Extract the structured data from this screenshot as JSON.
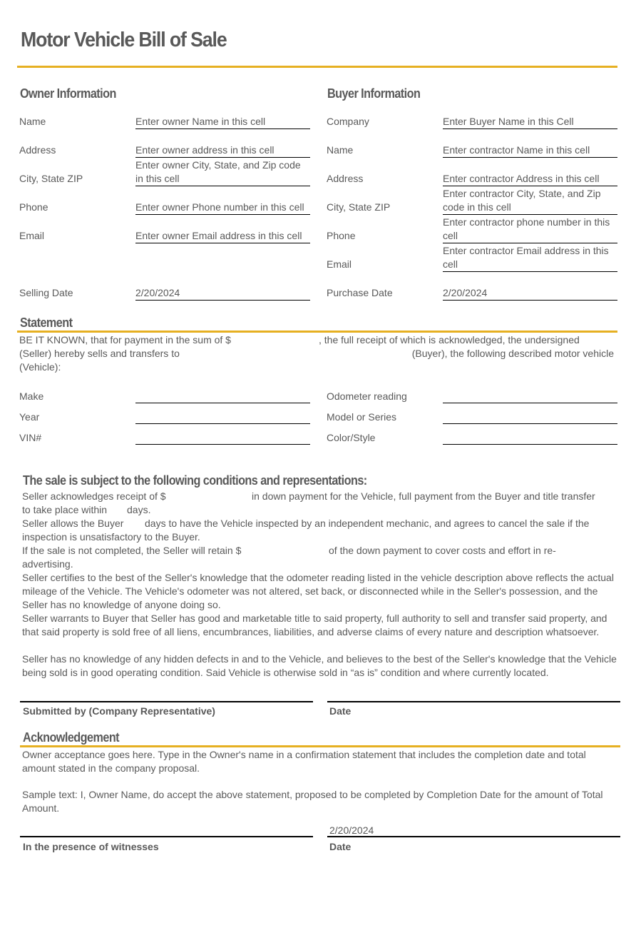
{
  "title": "Motor Vehicle Bill of Sale",
  "accent_color": "#E6B022",
  "owner": {
    "heading": "Owner Information",
    "fields": [
      {
        "label": "Name",
        "value": "Enter owner Name in this cell"
      },
      {
        "label": "Address",
        "value": "Enter owner address in this cell"
      },
      {
        "label": "City, State ZIP",
        "value": "Enter owner City, State, and Zip code in this cell"
      },
      {
        "label": "Phone",
        "value": "Enter owner Phone number in this cell"
      },
      {
        "label": "Email",
        "value": "Enter owner Email address in this cell"
      }
    ],
    "date_label": "Selling Date",
    "date_value": "2/20/2024"
  },
  "buyer": {
    "heading": "Buyer Information",
    "fields": [
      {
        "label": "Company",
        "value": "Enter Buyer Name in this Cell"
      },
      {
        "label": "Name",
        "value": "Enter contractor Name in this cell"
      },
      {
        "label": "Address",
        "value": "Enter contractor Address in this cell"
      },
      {
        "label": "City, State ZIP",
        "value": "Enter contractor City, State, and Zip code in this cell"
      },
      {
        "label": "Phone",
        "value": "Enter contractor phone number in this cell"
      },
      {
        "label": "Email",
        "value": "Enter contractor Email address in this cell"
      }
    ],
    "date_label": "Purchase Date",
    "date_value": "2/20/2024"
  },
  "statement": {
    "heading": "Statement",
    "line1a": "BE IT KNOWN, that for payment in the sum of $",
    "line1b": ", the full receipt of which is acknowledged, the undersigned",
    "line2a": "(Seller) hereby sells and transfers to",
    "line2b": "(Buyer), the following described motor vehicle",
    "line3": "(Vehicle):"
  },
  "vehicle": {
    "left": [
      {
        "label": "Make",
        "value": ""
      },
      {
        "label": "Year",
        "value": ""
      },
      {
        "label": "VIN#",
        "value": ""
      }
    ],
    "right": [
      {
        "label": "Odometer reading",
        "value": ""
      },
      {
        "label": "Model or Series",
        "value": ""
      },
      {
        "label": "Color/Style",
        "value": ""
      }
    ]
  },
  "conditions": {
    "heading": "The sale is subject to the following conditions and representations:",
    "lines": [
      {
        "a": "Seller acknowledges receipt of $",
        "b": "in down payment for the Vehicle, full payment from the Buyer and title transfer"
      },
      {
        "a": "to take place within",
        "b": "days."
      },
      {
        "a": "Seller allows the Buyer",
        "b": "days to have the Vehicle inspected by an independent mechanic, and agrees to cancel the sale if the"
      },
      {
        "a": "inspection is unsatisfactory to the Buyer.",
        "b": ""
      },
      {
        "a": "If the sale is not completed, the Seller will retain $",
        "b": "of the down payment to cover costs and effort in re-"
      },
      {
        "a": "advertising.",
        "b": ""
      }
    ],
    "paragraphs": [
      "Seller certifies to the best of the Seller's knowledge that the odometer reading listed in the vehicle description above reflects the actual mileage of the Vehicle. The Vehicle's odometer was not altered, set back, or disconnected while in the Seller's possession, and the Seller has no knowledge of anyone doing so.",
      "Seller warrants to Buyer that Seller has good and marketable title to said property, full authority to sell and transfer said property, and that said property is sold free of all liens, encumbrances, liabilities, and adverse claims of every nature and description whatsoever.",
      "Seller has no knowledge of any hidden defects in and to the Vehicle, and believes to the best of the Seller's knowledge that the Vehicle being sold is in good operating condition. Said Vehicle is otherwise sold in “as is” condition and where currently located."
    ]
  },
  "signatures1": {
    "left_label": "Submitted by (Company Representative)",
    "right_label": "Date",
    "right_value": ""
  },
  "acknowledgement": {
    "heading": "Acknowledgement",
    "para1": "Owner acceptance goes here. Type in the Owner's name in a confirmation statement that includes the completion date and total amount stated in the company proposal.",
    "para2": "Sample text: I, Owner Name, do accept the above statement, proposed to be completed by Completion Date for the amount of Total Amount."
  },
  "signatures2": {
    "left_label": "In the presence of witnesses",
    "right_label": "Date",
    "right_value": "2/20/2024"
  }
}
